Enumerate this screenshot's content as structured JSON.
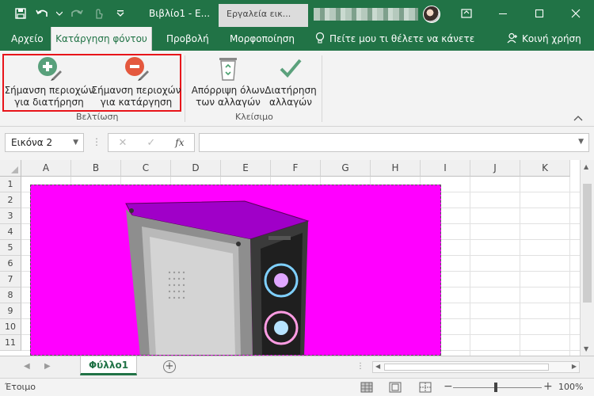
{
  "titlebar": {
    "document_title": "Βιβλίο1 - E...",
    "contextual_tab": "Εργαλεία εικ...",
    "buttons": [
      "save-icon",
      "undo-icon",
      "redo-icon",
      "touch-mode-icon",
      "customize-qat-icon"
    ],
    "window_controls": [
      "ribbon-display-options-icon",
      "minimize-icon",
      "maximize-icon",
      "close-icon"
    ]
  },
  "tabs": {
    "file": "Αρχείο",
    "background_removal": "Κατάργηση φόντου",
    "view": "Προβολή",
    "format": "Μορφοποίηση",
    "tell_me": "Πείτε μου τι θέλετε να κάνετε",
    "share": "Κοινή χρήση"
  },
  "ribbon": {
    "mark_keep": [
      "Σήμανση περιοχών",
      "για διατήρηση"
    ],
    "mark_remove": [
      "Σήμανση περιοχών",
      "για κατάργηση"
    ],
    "group_refine": "Βελτίωση",
    "discard": [
      "Απόρριψη όλων",
      "των αλλαγών"
    ],
    "keep_changes": [
      "Διατήρηση",
      "αλλαγών"
    ],
    "group_close": "Κλείσιμο"
  },
  "formula_bar": {
    "name_box": "Εικόνα 2",
    "fx": "fx",
    "cancel": "✕",
    "enter": "✓",
    "formula_value": ""
  },
  "grid": {
    "columns": [
      "A",
      "B",
      "C",
      "D",
      "E",
      "F",
      "G",
      "H",
      "I",
      "J",
      "K"
    ],
    "rows": [
      "1",
      "2",
      "3",
      "4",
      "5",
      "6",
      "7",
      "8",
      "9",
      "10",
      "11"
    ]
  },
  "sheet": {
    "active_tab": "Φύλλο1",
    "add_sheet": "+"
  },
  "status": {
    "ready": "Έτοιμο",
    "zoom": "100%",
    "zoom_minus": "−",
    "zoom_plus": "+"
  },
  "colors": {
    "excel_green": "#217346",
    "removal_magenta": "#ff00ff",
    "highlight_red": "#e8141a"
  }
}
